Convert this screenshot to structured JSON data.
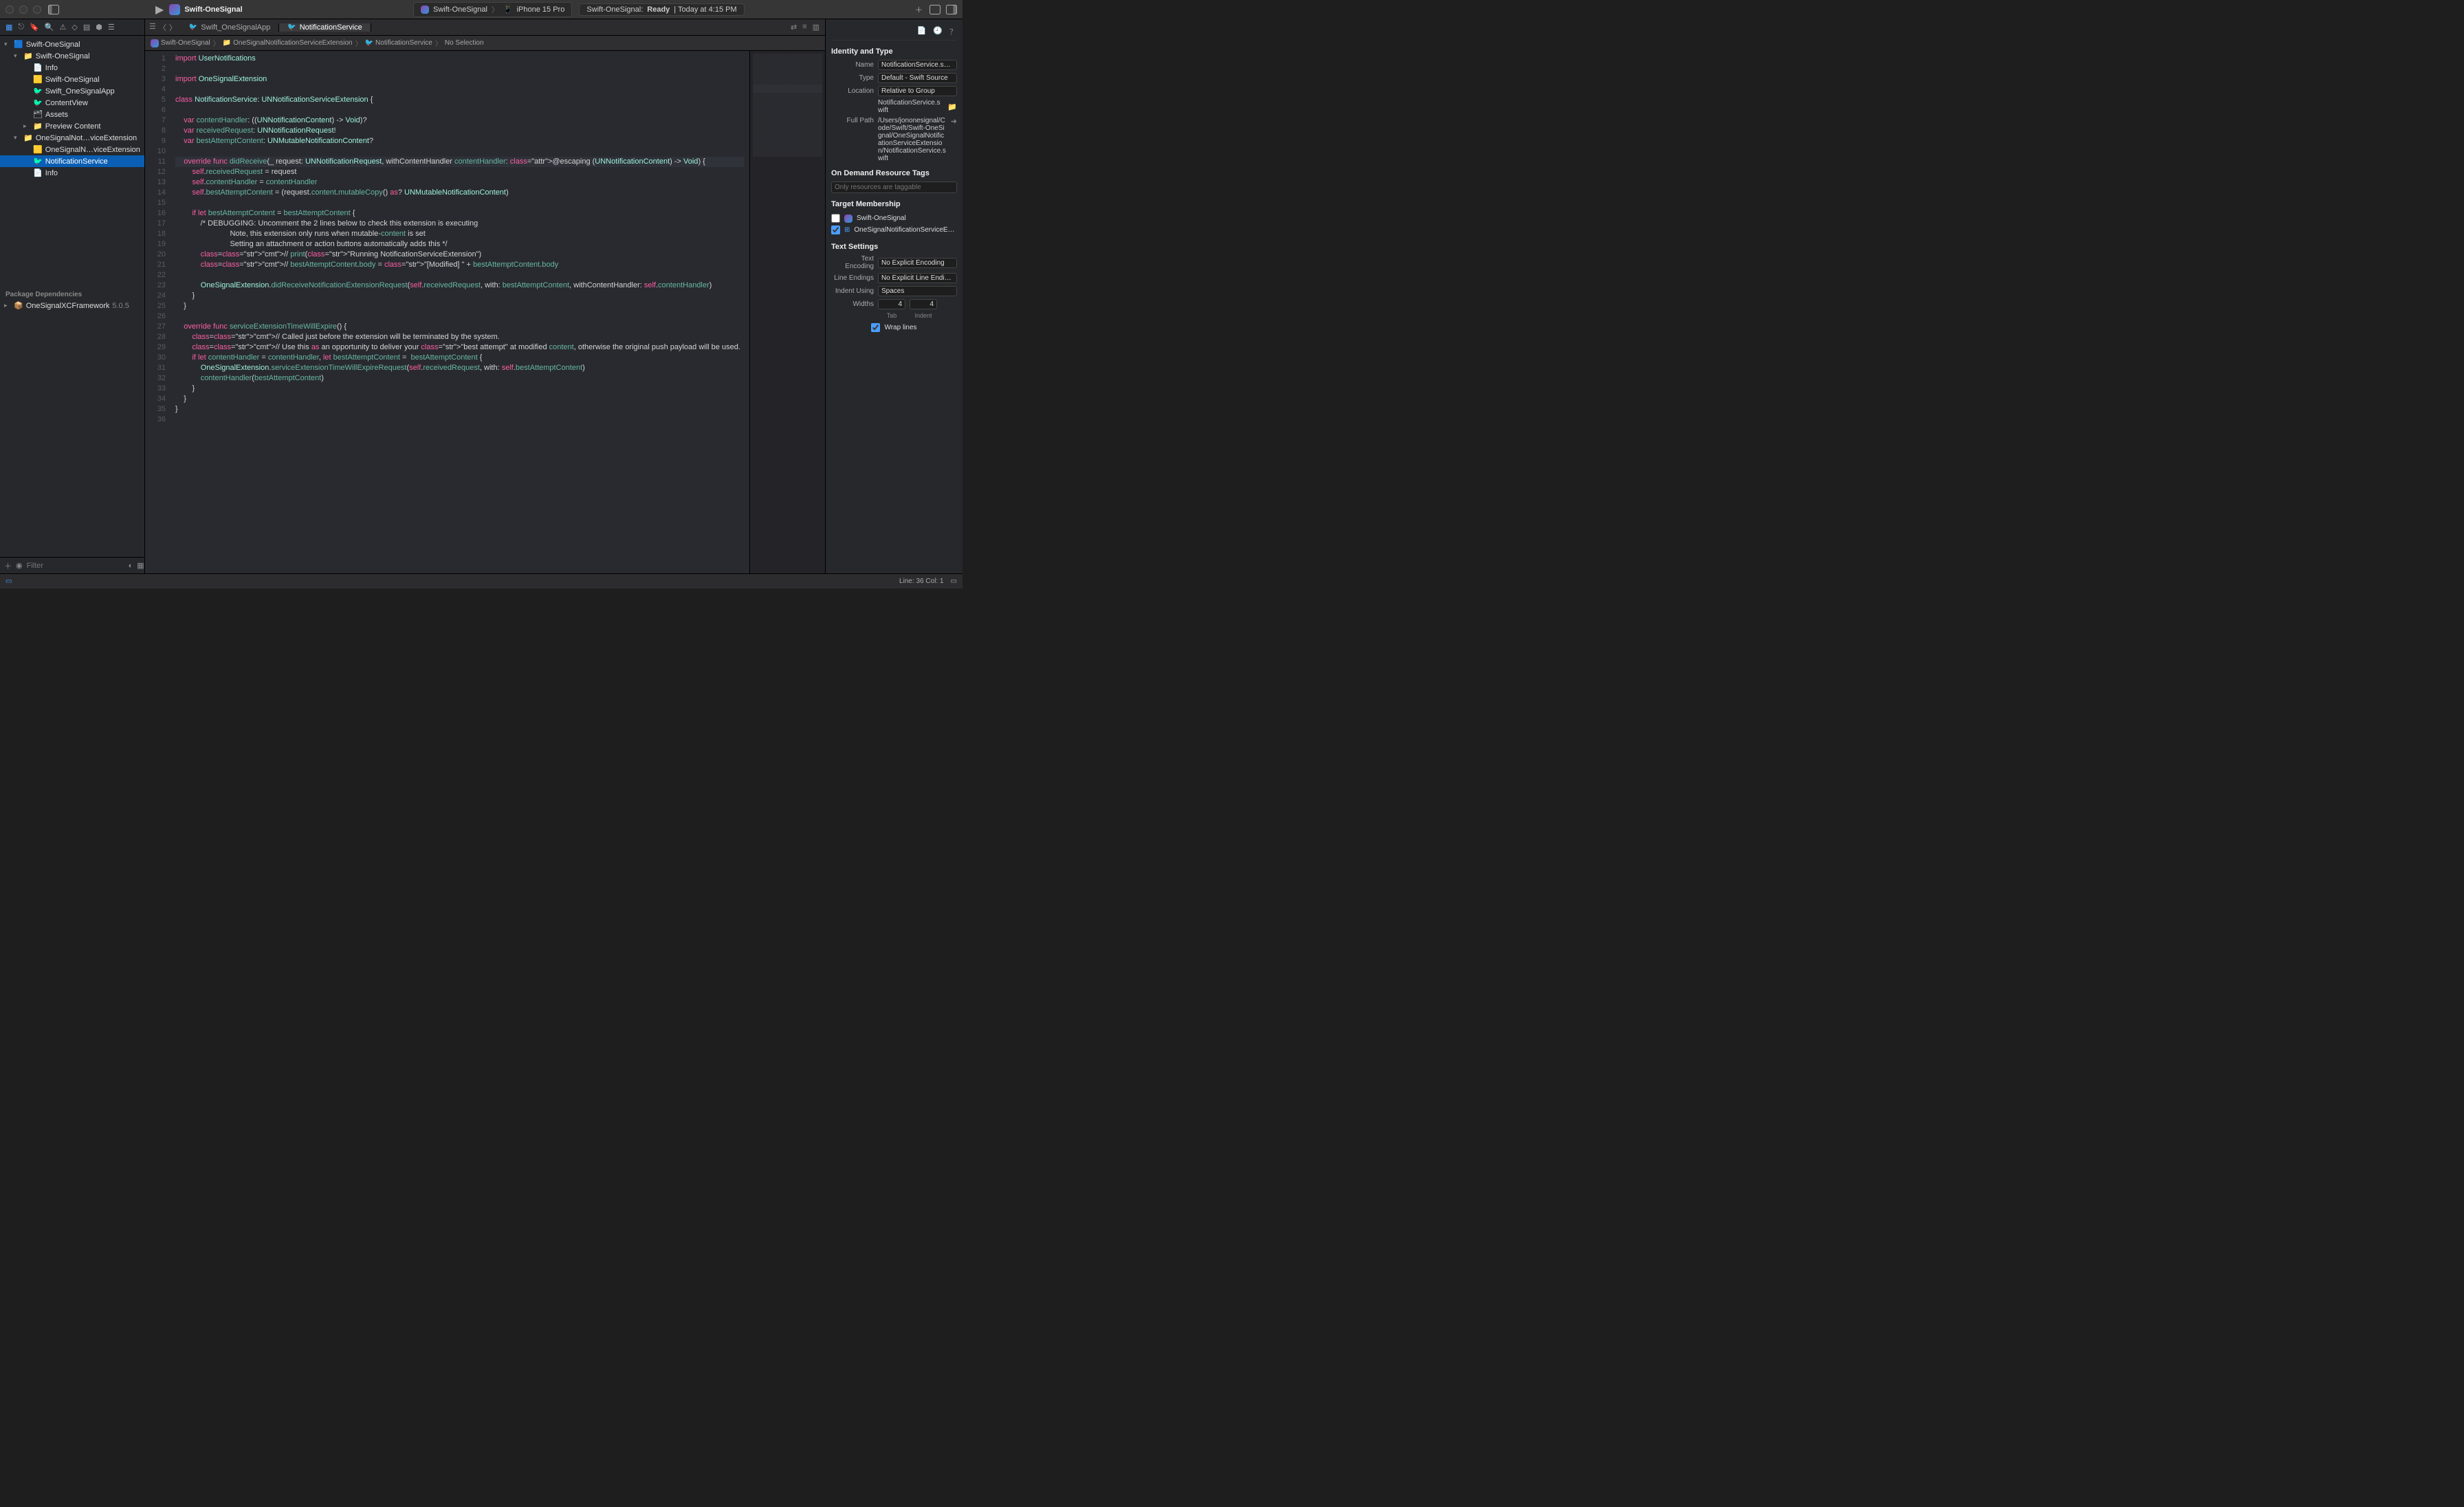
{
  "titlebar": {
    "project_name": "Swift-OneSignal",
    "scheme": "Swift-OneSignal",
    "destination": "iPhone 15 Pro",
    "status_prefix": "Swift-OneSignal:",
    "status_ready": "Ready",
    "status_time": "| Today at 4:15 PM"
  },
  "tabs": [
    {
      "label": "Swift_OneSignalApp",
      "active": false
    },
    {
      "label": "NotificationService",
      "active": true
    }
  ],
  "jump_bar": {
    "items": [
      "Swift-OneSignal",
      "OneSignalNotificationServiceExtension",
      "NotificationService",
      "No Selection"
    ]
  },
  "navigator": {
    "filter_placeholder": "Filter",
    "package_section": "Package Dependencies",
    "packages": [
      {
        "name": "OneSignalXCFramework",
        "version": "5.0.5"
      }
    ],
    "tree": [
      {
        "label": "Swift-OneSignal",
        "indent": 0,
        "icon": "app",
        "disclosure": "▾"
      },
      {
        "label": "Swift-OneSignal",
        "indent": 1,
        "icon": "folder",
        "disclosure": "▾"
      },
      {
        "label": "Info",
        "indent": 2,
        "icon": "plist"
      },
      {
        "label": "Swift-OneSignal",
        "indent": 2,
        "icon": "entitlements"
      },
      {
        "label": "Swift_OneSignalApp",
        "indent": 2,
        "icon": "swift"
      },
      {
        "label": "ContentView",
        "indent": 2,
        "icon": "swift"
      },
      {
        "label": "Assets",
        "indent": 2,
        "icon": "assets"
      },
      {
        "label": "Preview Content",
        "indent": 2,
        "icon": "folder",
        "disclosure": "▸"
      },
      {
        "label": "OneSignalNot…viceExtension",
        "indent": 1,
        "icon": "folder",
        "disclosure": "▾"
      },
      {
        "label": "OneSignalN…viceExtension",
        "indent": 2,
        "icon": "entitlements"
      },
      {
        "label": "NotificationService",
        "indent": 2,
        "icon": "swift",
        "selected": true
      },
      {
        "label": "Info",
        "indent": 2,
        "icon": "plist"
      }
    ]
  },
  "code": {
    "line_count": 36,
    "lines": [
      "import UserNotifications",
      "",
      "import OneSignalExtension",
      "",
      "class NotificationService: UNNotificationServiceExtension {",
      "",
      "    var contentHandler: ((UNNotificationContent) -> Void)?",
      "    var receivedRequest: UNNotificationRequest!",
      "    var bestAttemptContent: UNMutableNotificationContent?",
      "",
      "    override func didReceive(_ request: UNNotificationRequest, withContentHandler contentHandler: @escaping (UNNotificationContent) -> Void) {",
      "        self.receivedRequest = request",
      "        self.contentHandler = contentHandler",
      "        self.bestAttemptContent = (request.content.mutableCopy() as? UNMutableNotificationContent)",
      "",
      "        if let bestAttemptContent = bestAttemptContent {",
      "            /* DEBUGGING: Uncomment the 2 lines below to check this extension is executing",
      "                          Note, this extension only runs when mutable-content is set",
      "                          Setting an attachment or action buttons automatically adds this */",
      "            // print(\"Running NotificationServiceExtension\")",
      "            // bestAttemptContent.body = \"[Modified] \" + bestAttemptContent.body",
      "",
      "            OneSignalExtension.didReceiveNotificationExtensionRequest(self.receivedRequest, with: bestAttemptContent, withContentHandler: self.contentHandler)",
      "        }",
      "    }",
      "",
      "    override func serviceExtensionTimeWillExpire() {",
      "        // Called just before the extension will be terminated by the system.",
      "        // Use this as an opportunity to deliver your \"best attempt\" at modified content, otherwise the original push payload will be used.",
      "        if let contentHandler = contentHandler, let bestAttemptContent =  bestAttemptContent {",
      "            OneSignalExtension.serviceExtensionTimeWillExpireRequest(self.receivedRequest, with: self.bestAttemptContent)",
      "            contentHandler(bestAttemptContent)",
      "        }",
      "    }",
      "}",
      ""
    ]
  },
  "inspector": {
    "identity_header": "Identity and Type",
    "name_label": "Name",
    "name_value": "NotificationService.swift",
    "type_label": "Type",
    "type_value": "Default - Swift Source",
    "location_label": "Location",
    "location_value": "Relative to Group",
    "location_file": "NotificationService.swift",
    "fullpath_label": "Full Path",
    "fullpath_value": "/Users/jononesignal/Code/Swift/Swift-OneSignal/OneSignalNotificationServiceExtension/NotificationService.swift",
    "ondemand_header": "On Demand Resource Tags",
    "ondemand_placeholder": "Only resources are taggable",
    "target_header": "Target Membership",
    "targets": [
      {
        "name": "Swift-OneSignal",
        "checked": false
      },
      {
        "name": "OneSignalNotificationServiceExten…",
        "checked": true
      }
    ],
    "text_settings_header": "Text Settings",
    "encoding_label": "Text Encoding",
    "encoding_value": "No Explicit Encoding",
    "line_endings_label": "Line Endings",
    "line_endings_value": "No Explicit Line Endings",
    "indent_using_label": "Indent Using",
    "indent_using_value": "Spaces",
    "widths_label": "Widths",
    "tab_value": "4",
    "indent_value": "4",
    "tab_label": "Tab",
    "indent_label": "Indent",
    "wrap_label": "Wrap lines",
    "wrap_checked": true
  },
  "debug_bar": {
    "cursor": "Line: 36   Col: 1"
  }
}
